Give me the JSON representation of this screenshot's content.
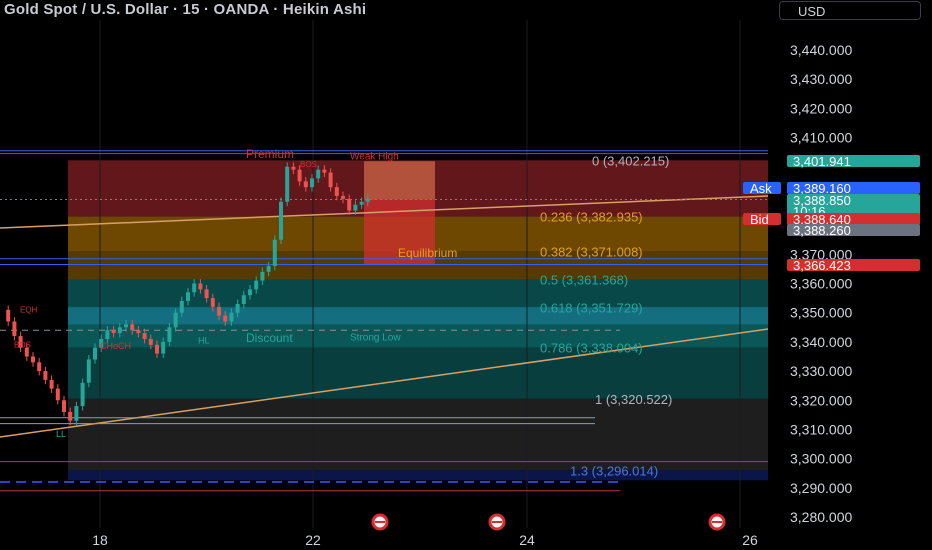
{
  "header": {
    "title": "Gold Spot / U.S. Dollar · 15 · OANDA · Heikin Ashi",
    "currency": "USD"
  },
  "colors": {
    "background": "#000000",
    "up_candle": "#26a69a",
    "down_candle": "#ef5350",
    "premium_zone": "#7a1d22",
    "discount_zone": "#0a5a5a",
    "extension_zone": "#0d1a5c",
    "orange_zone": "#8a5a00",
    "trendline": "#d9a066",
    "blue_line": "#3d5afe"
  },
  "chart_data": {
    "type": "candlestick",
    "title": "Gold Spot / U.S. Dollar · 15 · OANDA · Heikin Ashi",
    "ylim": [
      3275,
      3448
    ],
    "y_ticks": [
      "3,440.000",
      "3,430.000",
      "3,420.000",
      "3,410.000",
      "3,370.000",
      "3,360.000",
      "3,350.000",
      "3,340.000",
      "3,330.000",
      "3,320.000",
      "3,310.000",
      "3,300.000",
      "3,290.000",
      "3,280.000"
    ],
    "x_ticks": [
      "18",
      "22",
      "24",
      "26"
    ],
    "price_series": [
      3351,
      3347,
      3342,
      3338,
      3335,
      3333,
      3330,
      3327,
      3324,
      3320,
      3316,
      3313,
      3318,
      3326,
      3334,
      3338,
      3341,
      3344,
      3343,
      3345,
      3346,
      3344,
      3343,
      3341,
      3339,
      3336,
      3340,
      3345,
      3350,
      3354,
      3357,
      3360,
      3358,
      3355,
      3352,
      3349,
      3347,
      3350,
      3353,
      3356,
      3358,
      3361,
      3364,
      3366,
      3375,
      3388,
      3400,
      3399,
      3395,
      3393,
      3396,
      3399,
      3398,
      3393,
      3390,
      3389,
      3385,
      3387,
      3388,
      3389
    ],
    "price_labels": [
      {
        "label": "",
        "value": "3,401.941",
        "price": 3401.941,
        "color": "#26a69a"
      },
      {
        "label": "Ask",
        "value": "3,389.160",
        "price": 3389.16,
        "color": "#2962ff"
      },
      {
        "label": "",
        "value": "3,388.850",
        "sub": "10:16",
        "price": 3388.85,
        "color": "#26a69a"
      },
      {
        "label": "Bid",
        "value": "3,388.640",
        "price": 3388.64,
        "color": "#d32f2f"
      },
      {
        "label": "",
        "value": "3,388.260",
        "price": 3388.26,
        "color": "#6b7280"
      },
      {
        "label": "",
        "value": "3,366.423",
        "price": 3366.423,
        "color": "#d32f2f"
      }
    ],
    "fib_levels": [
      {
        "label": "0 (3,402.215)",
        "price": 3402.215
      },
      {
        "label": "0.236 (3,382.935)",
        "price": 3382.935
      },
      {
        "label": "0.382 (3,371.008)",
        "price": 3371.008
      },
      {
        "label": "0.5 (3,361.368)",
        "price": 3361.368
      },
      {
        "label": "0.618 (3,351.729)",
        "price": 3351.729
      },
      {
        "label": "0.786 (3,338.004)",
        "price": 3338.004
      },
      {
        "label": "1 (3,320.522)",
        "price": 3320.522
      },
      {
        "label": "1.3 (3,296.014)",
        "price": 3296.014
      }
    ],
    "annotations": [
      "Premium",
      "Weak High",
      "BOS",
      "Equilibrium",
      "Discount",
      "Strong Low",
      "LL",
      "CHoCH",
      "BOS",
      "EQH",
      "HL"
    ],
    "zones": [
      "Premium",
      "Equilibrium",
      "Discount"
    ]
  }
}
